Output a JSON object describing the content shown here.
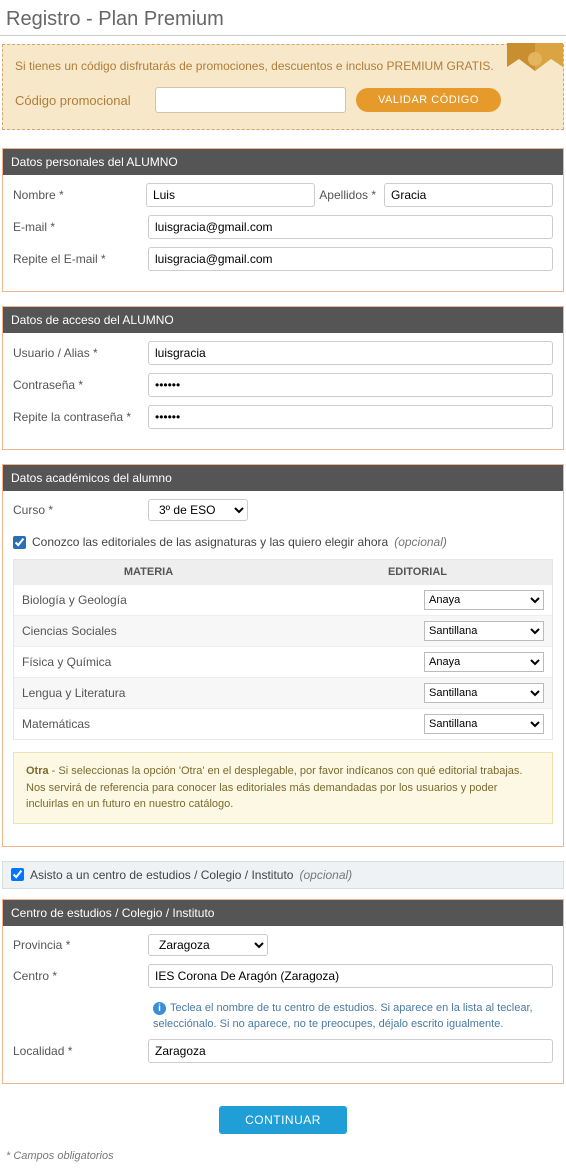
{
  "page_title": "Registro - Plan Premium",
  "promo": {
    "message": "Si tienes un código disfrutarás de promociones, descuentos e incluso PREMIUM GRATIS.",
    "label": "Código promocional",
    "value": "",
    "button": "VALIDAR CÓDIGO"
  },
  "personal": {
    "header": "Datos personales del ALUMNO",
    "nombre_label": "Nombre *",
    "nombre_value": "Luis",
    "apellidos_label": "Apellidos *",
    "apellidos_value": "Gracia",
    "email_label": "E-mail *",
    "email_value": "luisgracia@gmail.com",
    "email2_label": "Repite el E-mail *",
    "email2_value": "luisgracia@gmail.com"
  },
  "access": {
    "header": "Datos de acceso del ALUMNO",
    "user_label": "Usuario / Alias *",
    "user_value": "luisgracia",
    "pass_label": "Contraseña *",
    "pass_value": "••••••",
    "pass2_label": "Repite la contraseña *",
    "pass2_value": "••••••"
  },
  "academic": {
    "header": "Datos académicos del alumno",
    "curso_label": "Curso *",
    "curso_value": "3º de ESO",
    "check_label": "Conozco las editoriales de las asignaturas y las quiero elegir ahora",
    "optional": "(opcional)",
    "col_materia": "MATERIA",
    "col_editorial": "EDITORIAL",
    "subjects": [
      {
        "name": "Biología y Geología",
        "editorial": "Anaya"
      },
      {
        "name": "Ciencias Sociales",
        "editorial": "Santillana"
      },
      {
        "name": "Física y Química",
        "editorial": "Anaya"
      },
      {
        "name": "Lengua y Literatura",
        "editorial": "Santillana"
      },
      {
        "name": "Matemáticas",
        "editorial": "Santillana"
      }
    ],
    "note_bold": "Otra",
    "note_text": " - Si seleccionas la opción 'Otra' en el desplegable, por favor indícanos con qué editorial trabajas. Nos servirá de referencia para conocer las editoriales más demandadas por los usuarios y poder incluirlas en un futuro en nuestro catálogo."
  },
  "school_check": {
    "label": "Asisto a un centro de estudios / Colegio / Instituto",
    "optional": "(opcional)"
  },
  "school": {
    "header": "Centro de estudios / Colegio / Instituto",
    "prov_label": "Provincia *",
    "prov_value": "Zaragoza",
    "centro_label": "Centro *",
    "centro_value": "IES Corona De Aragón (Zaragoza)",
    "hint": "Teclea el nombre de tu centro de estudios. Si aparece en la lista al teclear, selecciónalo. Si no aparece, no te preocupes, déjalo escrito igualmente.",
    "loc_label": "Localidad *",
    "loc_value": "Zaragoza"
  },
  "continuar": "CONTINUAR",
  "footnote": "* Campos obligatorios"
}
